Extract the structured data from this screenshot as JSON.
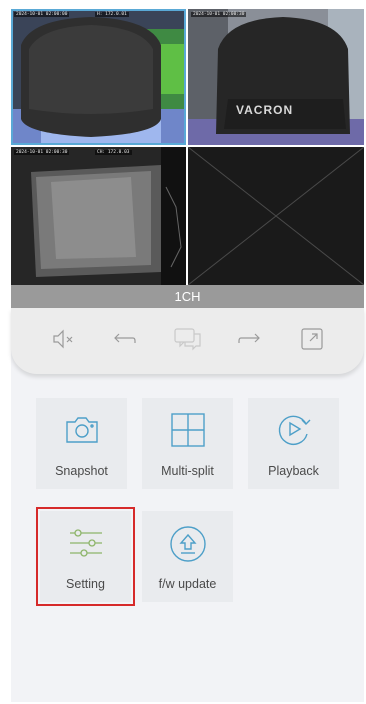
{
  "cameras": [
    {
      "id": "cam-1",
      "timestamp": "2024-10-01 02:00:00",
      "channel": "H: 172.0.01",
      "view": "round-device-blue-glow"
    },
    {
      "id": "cam-2",
      "timestamp": "2024-10-01 02:00:30",
      "channel": "",
      "view": "vacron-device",
      "brand_text": "VACRON"
    },
    {
      "id": "cam-3",
      "timestamp": "2024-10-01 02:00:30",
      "channel": "CH: 172.0.03",
      "view": "dark-monitor"
    },
    {
      "id": "cam-4",
      "timestamp": "",
      "channel": "",
      "view": "empty-slot"
    }
  ],
  "channel_bar": {
    "label": "1CH"
  },
  "controls": [
    {
      "name": "mute-icon"
    },
    {
      "name": "undo-icon"
    },
    {
      "name": "chat-icon"
    },
    {
      "name": "redo-icon"
    },
    {
      "name": "expand-icon"
    }
  ],
  "menu": [
    {
      "label": "Snapshot",
      "icon": "camera-icon"
    },
    {
      "label": "Multi-split",
      "icon": "grid-icon"
    },
    {
      "label": "Playback",
      "icon": "playback-icon"
    },
    {
      "label": "Setting",
      "icon": "sliders-icon",
      "highlighted": true
    },
    {
      "label": "f/w update",
      "icon": "upload-icon"
    }
  ],
  "colors": {
    "icon_blue": "#4d9fc8",
    "icon_green": "#8db56a",
    "highlight_red": "#d62a2a",
    "channel_bar": "#9a9a9a"
  }
}
